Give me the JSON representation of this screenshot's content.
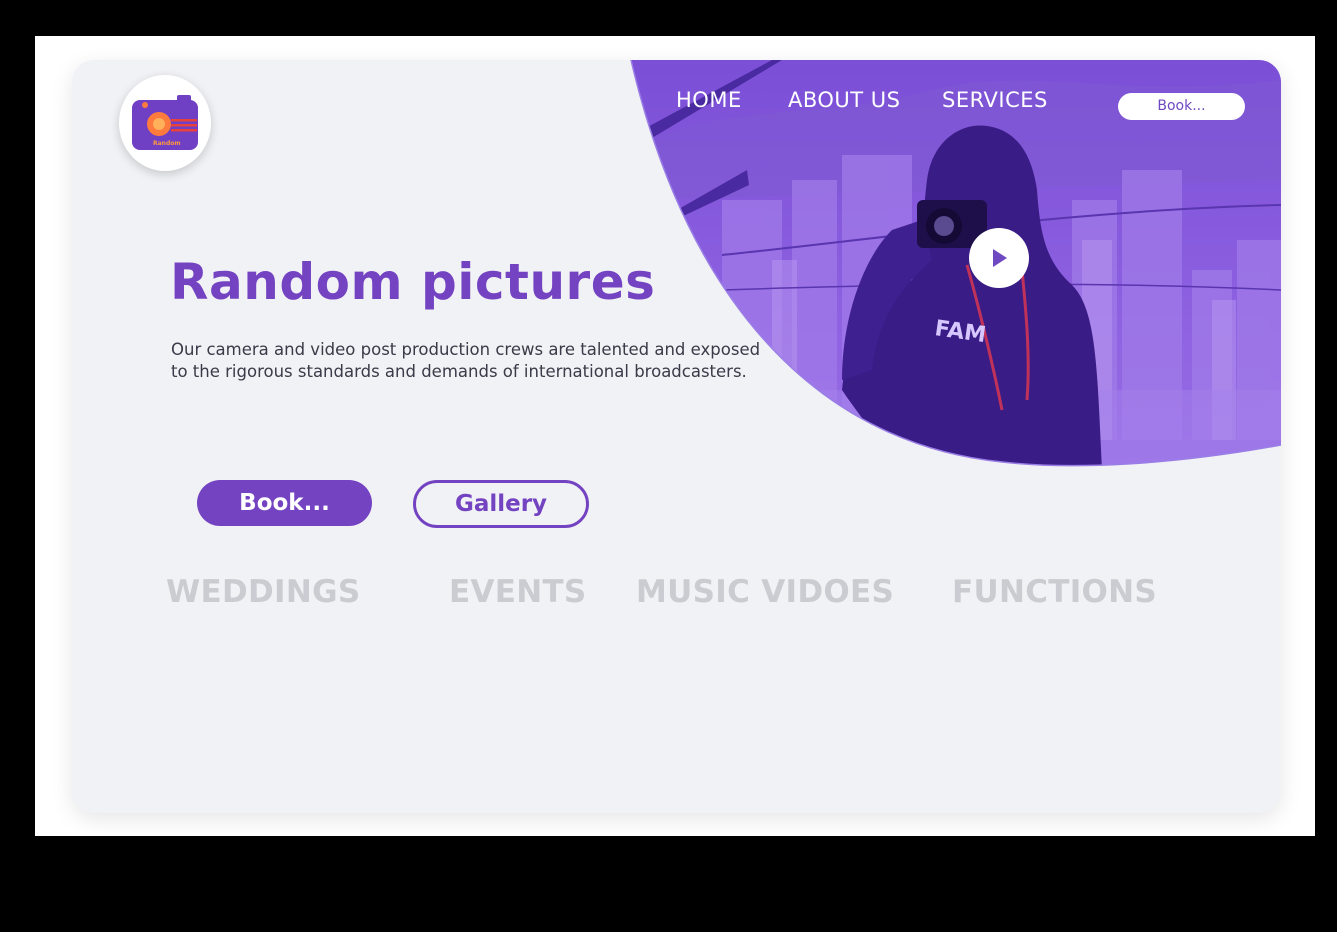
{
  "logo": {
    "icon": "camera-logo-icon",
    "text": "Random",
    "colors": {
      "body": "#6f3fc4",
      "lens": "#ff7a3d",
      "stripes": "#e8413c"
    }
  },
  "nav": {
    "items": [
      {
        "label": "HOME"
      },
      {
        "label": "ABOUT US"
      },
      {
        "label": "SERVICES"
      }
    ],
    "book_label": "Book..."
  },
  "hero": {
    "image": "photographer-with-camera-city-background",
    "play_icon": "play-icon",
    "title": "Random pictures",
    "description": "Our camera and video post production crews are talented and exposed to the rigorous standards and demands of international broadcasters.",
    "book_button": "Book...",
    "gallery_button": "Gallery"
  },
  "categories": [
    {
      "label": "WEDDINGS"
    },
    {
      "label": "EVENTS"
    },
    {
      "label": "MUSIC VIDOES"
    },
    {
      "label": "FUNCTIONS"
    }
  ],
  "colors": {
    "accent": "#7443c2",
    "page_bg": "#f1f2f5",
    "category_text": "#cbccd1"
  }
}
